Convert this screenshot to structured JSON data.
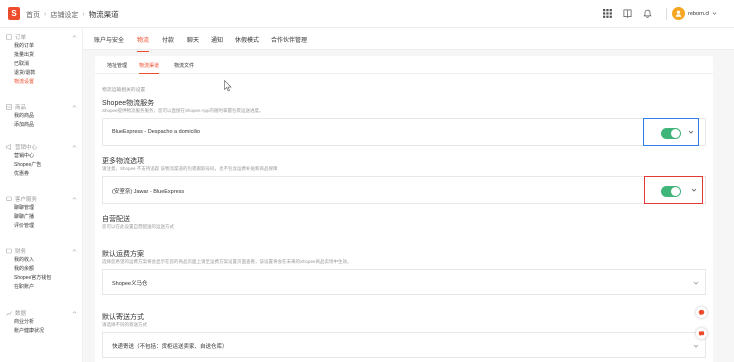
{
  "header": {
    "breadcrumbs": [
      "首页",
      "店铺设定",
      "物流渠道"
    ],
    "username": "reborn.cl",
    "icons": [
      "grid-icon",
      "book-icon",
      "bell-icon"
    ]
  },
  "sidebar": {
    "groups": [
      {
        "title": "订单",
        "icon": "order-icon",
        "items": [
          "我的订单",
          "批量出货",
          "已取消",
          "退货/退款",
          "物流设置"
        ],
        "active_index": 4
      },
      {
        "title": "商品",
        "icon": "product-icon",
        "items": [
          "我的商品",
          "添加商品"
        ]
      },
      {
        "title": "营销中心",
        "icon": "marketing-icon",
        "items": [
          "营销中心",
          "Shopee广告",
          "优惠券"
        ]
      },
      {
        "title": "客户服务",
        "icon": "service-icon",
        "items": [
          "聊聊管理",
          "聊聊广播",
          "评价管理"
        ]
      },
      {
        "title": "财务",
        "icon": "finance-icon",
        "items": [
          "我的收入",
          "我的余额",
          "Shopee官方钱包",
          "在职账户"
        ]
      },
      {
        "title": "数据",
        "icon": "data-icon",
        "items": [
          "商业分析",
          "账户健康状况"
        ]
      }
    ]
  },
  "main": {
    "tabs": [
      "账户与安全",
      "物流",
      "付款",
      "聊天",
      "通知",
      "休假模式",
      "合作伙伴管理"
    ],
    "active_tab": 1,
    "subtabs": [
      "地址管理",
      "物流渠道",
      "物流文件"
    ],
    "active_subtab": 1,
    "hint": "物流运输相关的设置",
    "sections": {
      "shopee": {
        "title": "Shopee物流服务",
        "desc": "Shopee提供物流服务服务，您可以直接在Shopee App内随时掌握包裹运送进度。",
        "channel": "BlueExpress - Despacho a domicilio",
        "enabled": true
      },
      "more": {
        "title": "更多物流选项",
        "desc": "请注意，Shopee 不支持追踪 该物流渠道的包裹跟踪号码，也不包含运费补贴和商品保障",
        "channel": "(安室奈) Jawar - BlueExpress",
        "enabled": true
      },
      "bulky": {
        "title": "自营配送",
        "desc": "您可以在此设置自营配送的运送方式"
      },
      "default_tpl": {
        "title": "默认运费方案",
        "desc": "选择您希望的运费方案将会显示在您的商品页面上请至运费方案设置页面查看，该设置将会在未来的Shopee商品卖场中生效。",
        "value": "Shopee义马仓"
      },
      "default_ship": {
        "title": "默认寄送方式",
        "desc": "请选择不同的寄送方式",
        "value": "快递寄送（不包括：货柜运送卖家、自送仓库）"
      }
    }
  },
  "colors": {
    "accent": "#ee4d2d",
    "toggle_on": "#3fb57a",
    "highlight_blue": "#2f7fe8",
    "highlight_red": "#e53935"
  }
}
